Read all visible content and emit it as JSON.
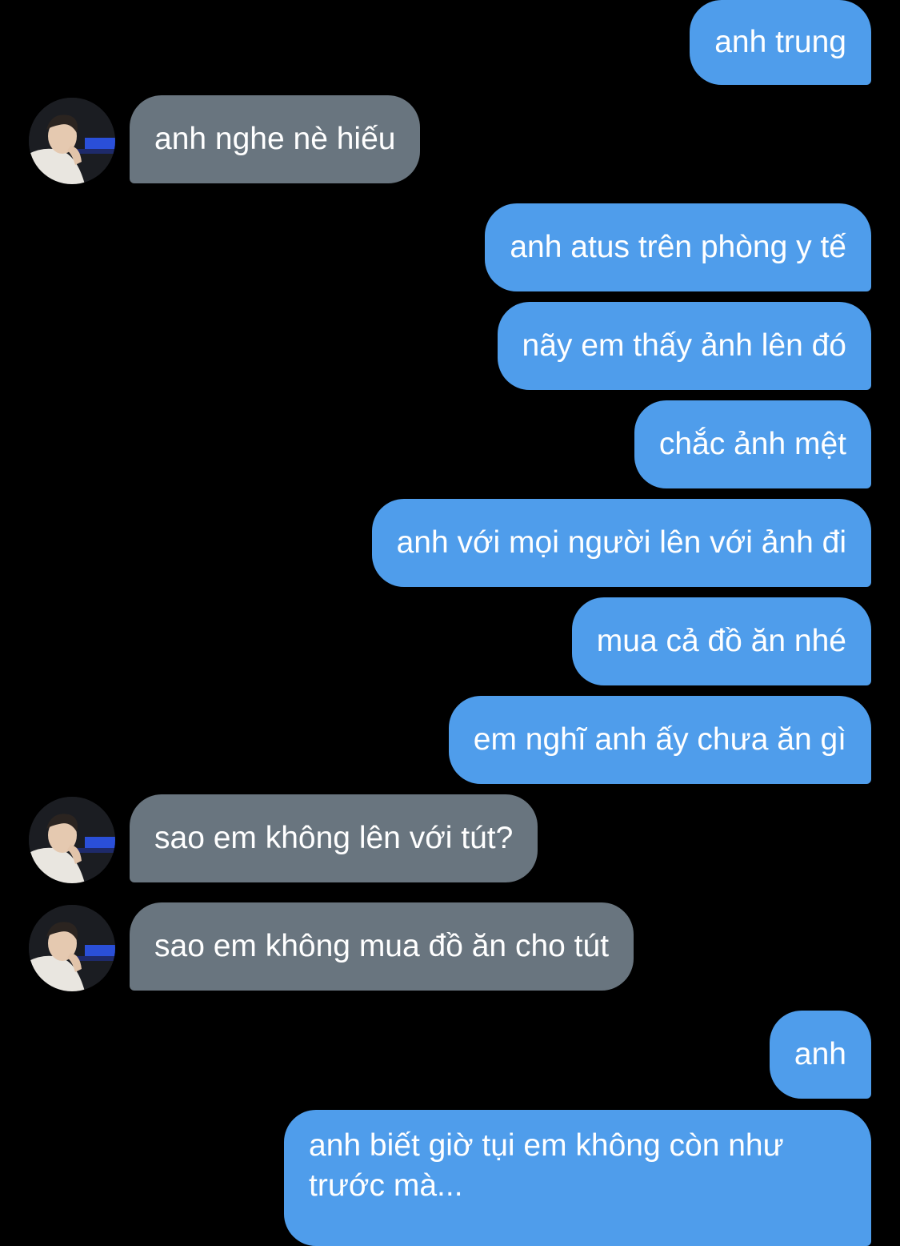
{
  "conversation": {
    "colors": {
      "background": "#000000",
      "sent_bubble": "#4f9deb",
      "received_bubble": "#69757f",
      "text": "#ffffff"
    },
    "messages": [
      {
        "direction": "sent",
        "text": "anh trung"
      },
      {
        "direction": "received",
        "text": "anh nghe nè hiếu"
      },
      {
        "direction": "sent",
        "text": "anh atus trên phòng y tế"
      },
      {
        "direction": "sent",
        "text": "nãy em thấy ảnh lên đó"
      },
      {
        "direction": "sent",
        "text": "chắc ảnh mệt"
      },
      {
        "direction": "sent",
        "text": "anh với mọi người lên với ảnh đi"
      },
      {
        "direction": "sent",
        "text": "mua cả đồ ăn nhé"
      },
      {
        "direction": "sent",
        "text": "em nghĩ anh ấy chưa ăn gì"
      },
      {
        "direction": "received",
        "text": "sao em không lên với tút?"
      },
      {
        "direction": "received",
        "text": "sao em không mua đồ ăn cho tút"
      },
      {
        "direction": "sent",
        "text": "anh"
      },
      {
        "direction": "sent",
        "text": "anh biết giờ tụi em không còn như trước mà..."
      }
    ]
  }
}
